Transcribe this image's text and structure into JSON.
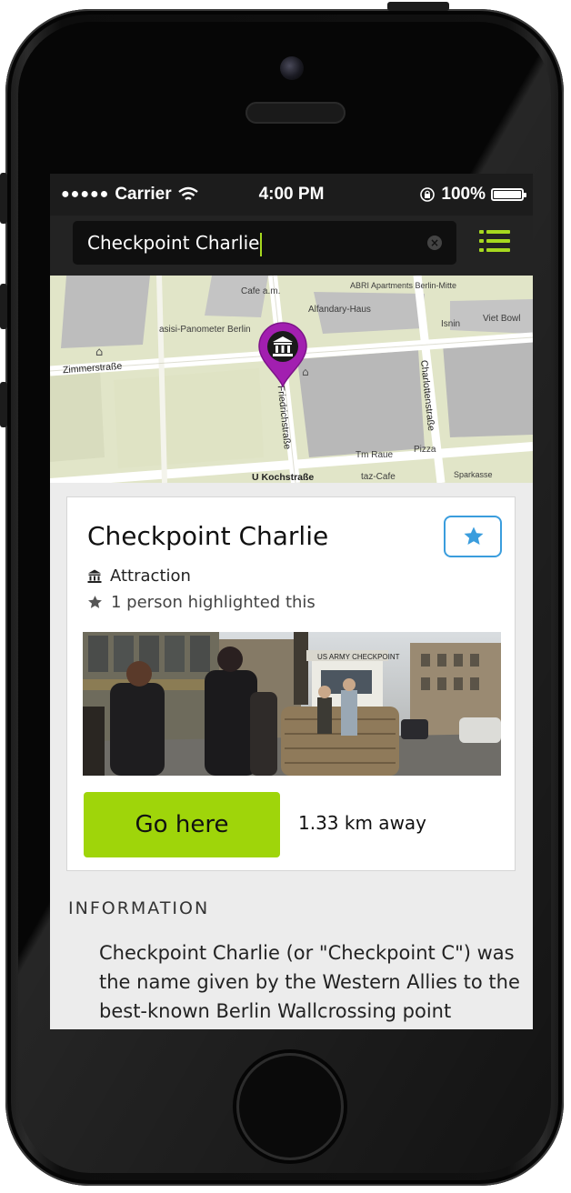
{
  "statusbar": {
    "signal": "●●●●●",
    "carrier": "Carrier",
    "time": "4:00 PM",
    "battery": "100%",
    "battery_level": 1.0
  },
  "search": {
    "value": "Checkpoint Charlie",
    "accent_color": "#a6d81f"
  },
  "map": {
    "labels": [
      "Cafe a.m.",
      "ABRI Apartments Berlin-Mitte",
      "Alfandary-Haus",
      "asisi-Panometer Berlin",
      "Isnin",
      "Viet Bowl",
      "Tm Raue",
      "Pizza",
      "taz-Cafe",
      "Sparkasse"
    ],
    "streets": [
      "Zimmerstraße",
      "Friedrichstraße",
      "Charlottenstraße",
      "U Kochstraße"
    ],
    "pin_color": "#a21fb0",
    "pin_icon": "museum-icon"
  },
  "place": {
    "title": "Checkpoint Charlie",
    "category": "Attraction",
    "category_icon": "museum-icon",
    "highlights": "1 person highlighted this",
    "favorite_icon": "star-icon",
    "photo_sign_text": "US ARMY CHECKPOINT",
    "go_label": "Go here",
    "distance": "1.33 km away",
    "accent_color": "#9fd50a",
    "favorite_color": "#3a9ddd"
  },
  "information": {
    "heading": "INFORMATION",
    "text": "Checkpoint Charlie (or \"Checkpoint C\") was the name given by the Western Allies to the best-known Berlin Wallcrossing point"
  }
}
